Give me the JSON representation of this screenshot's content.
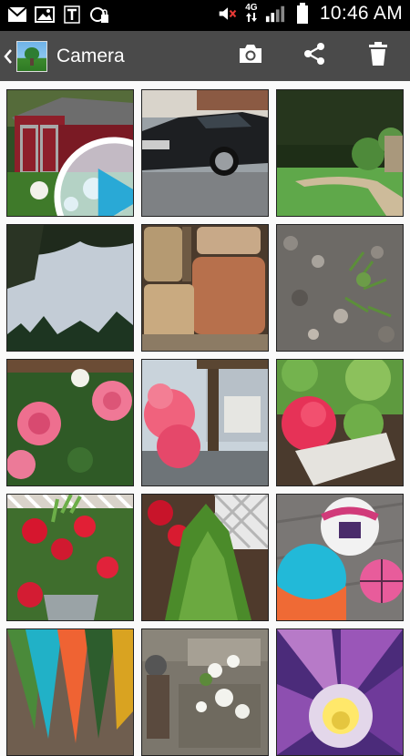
{
  "status_bar": {
    "time": "10:46 AM",
    "network": "4G",
    "icons": [
      "gmail-icon",
      "gallery-notification-icon",
      "tmobile-icon",
      "wifi-connect-icon",
      "mute-icon",
      "signal-icon",
      "battery-icon"
    ]
  },
  "action_bar": {
    "title": "Camera",
    "actions": [
      "camera-icon",
      "share-icon",
      "delete-icon"
    ]
  },
  "grid": {
    "photos": [
      {
        "name": "red-shed",
        "type": "video"
      },
      {
        "name": "black-car",
        "type": "photo"
      },
      {
        "name": "garden-path",
        "type": "photo"
      },
      {
        "name": "sky-trees",
        "type": "photo"
      },
      {
        "name": "stone-wall",
        "type": "photo"
      },
      {
        "name": "gravel-weeds",
        "type": "photo"
      },
      {
        "name": "pink-roses",
        "type": "photo"
      },
      {
        "name": "pink-geranium-fence",
        "type": "photo"
      },
      {
        "name": "geranium-pot",
        "type": "photo"
      },
      {
        "name": "red-geranium-planter",
        "type": "photo"
      },
      {
        "name": "shrub-lattice",
        "type": "photo"
      },
      {
        "name": "balls",
        "type": "photo"
      },
      {
        "name": "colorful-umbrella",
        "type": "photo"
      },
      {
        "name": "patio-flowers",
        "type": "photo"
      },
      {
        "name": "purple-flower",
        "type": "photo"
      }
    ]
  },
  "colors": {
    "status_bar": "#000000",
    "action_bar": "#4a4a4a",
    "background": "#fafafa"
  }
}
